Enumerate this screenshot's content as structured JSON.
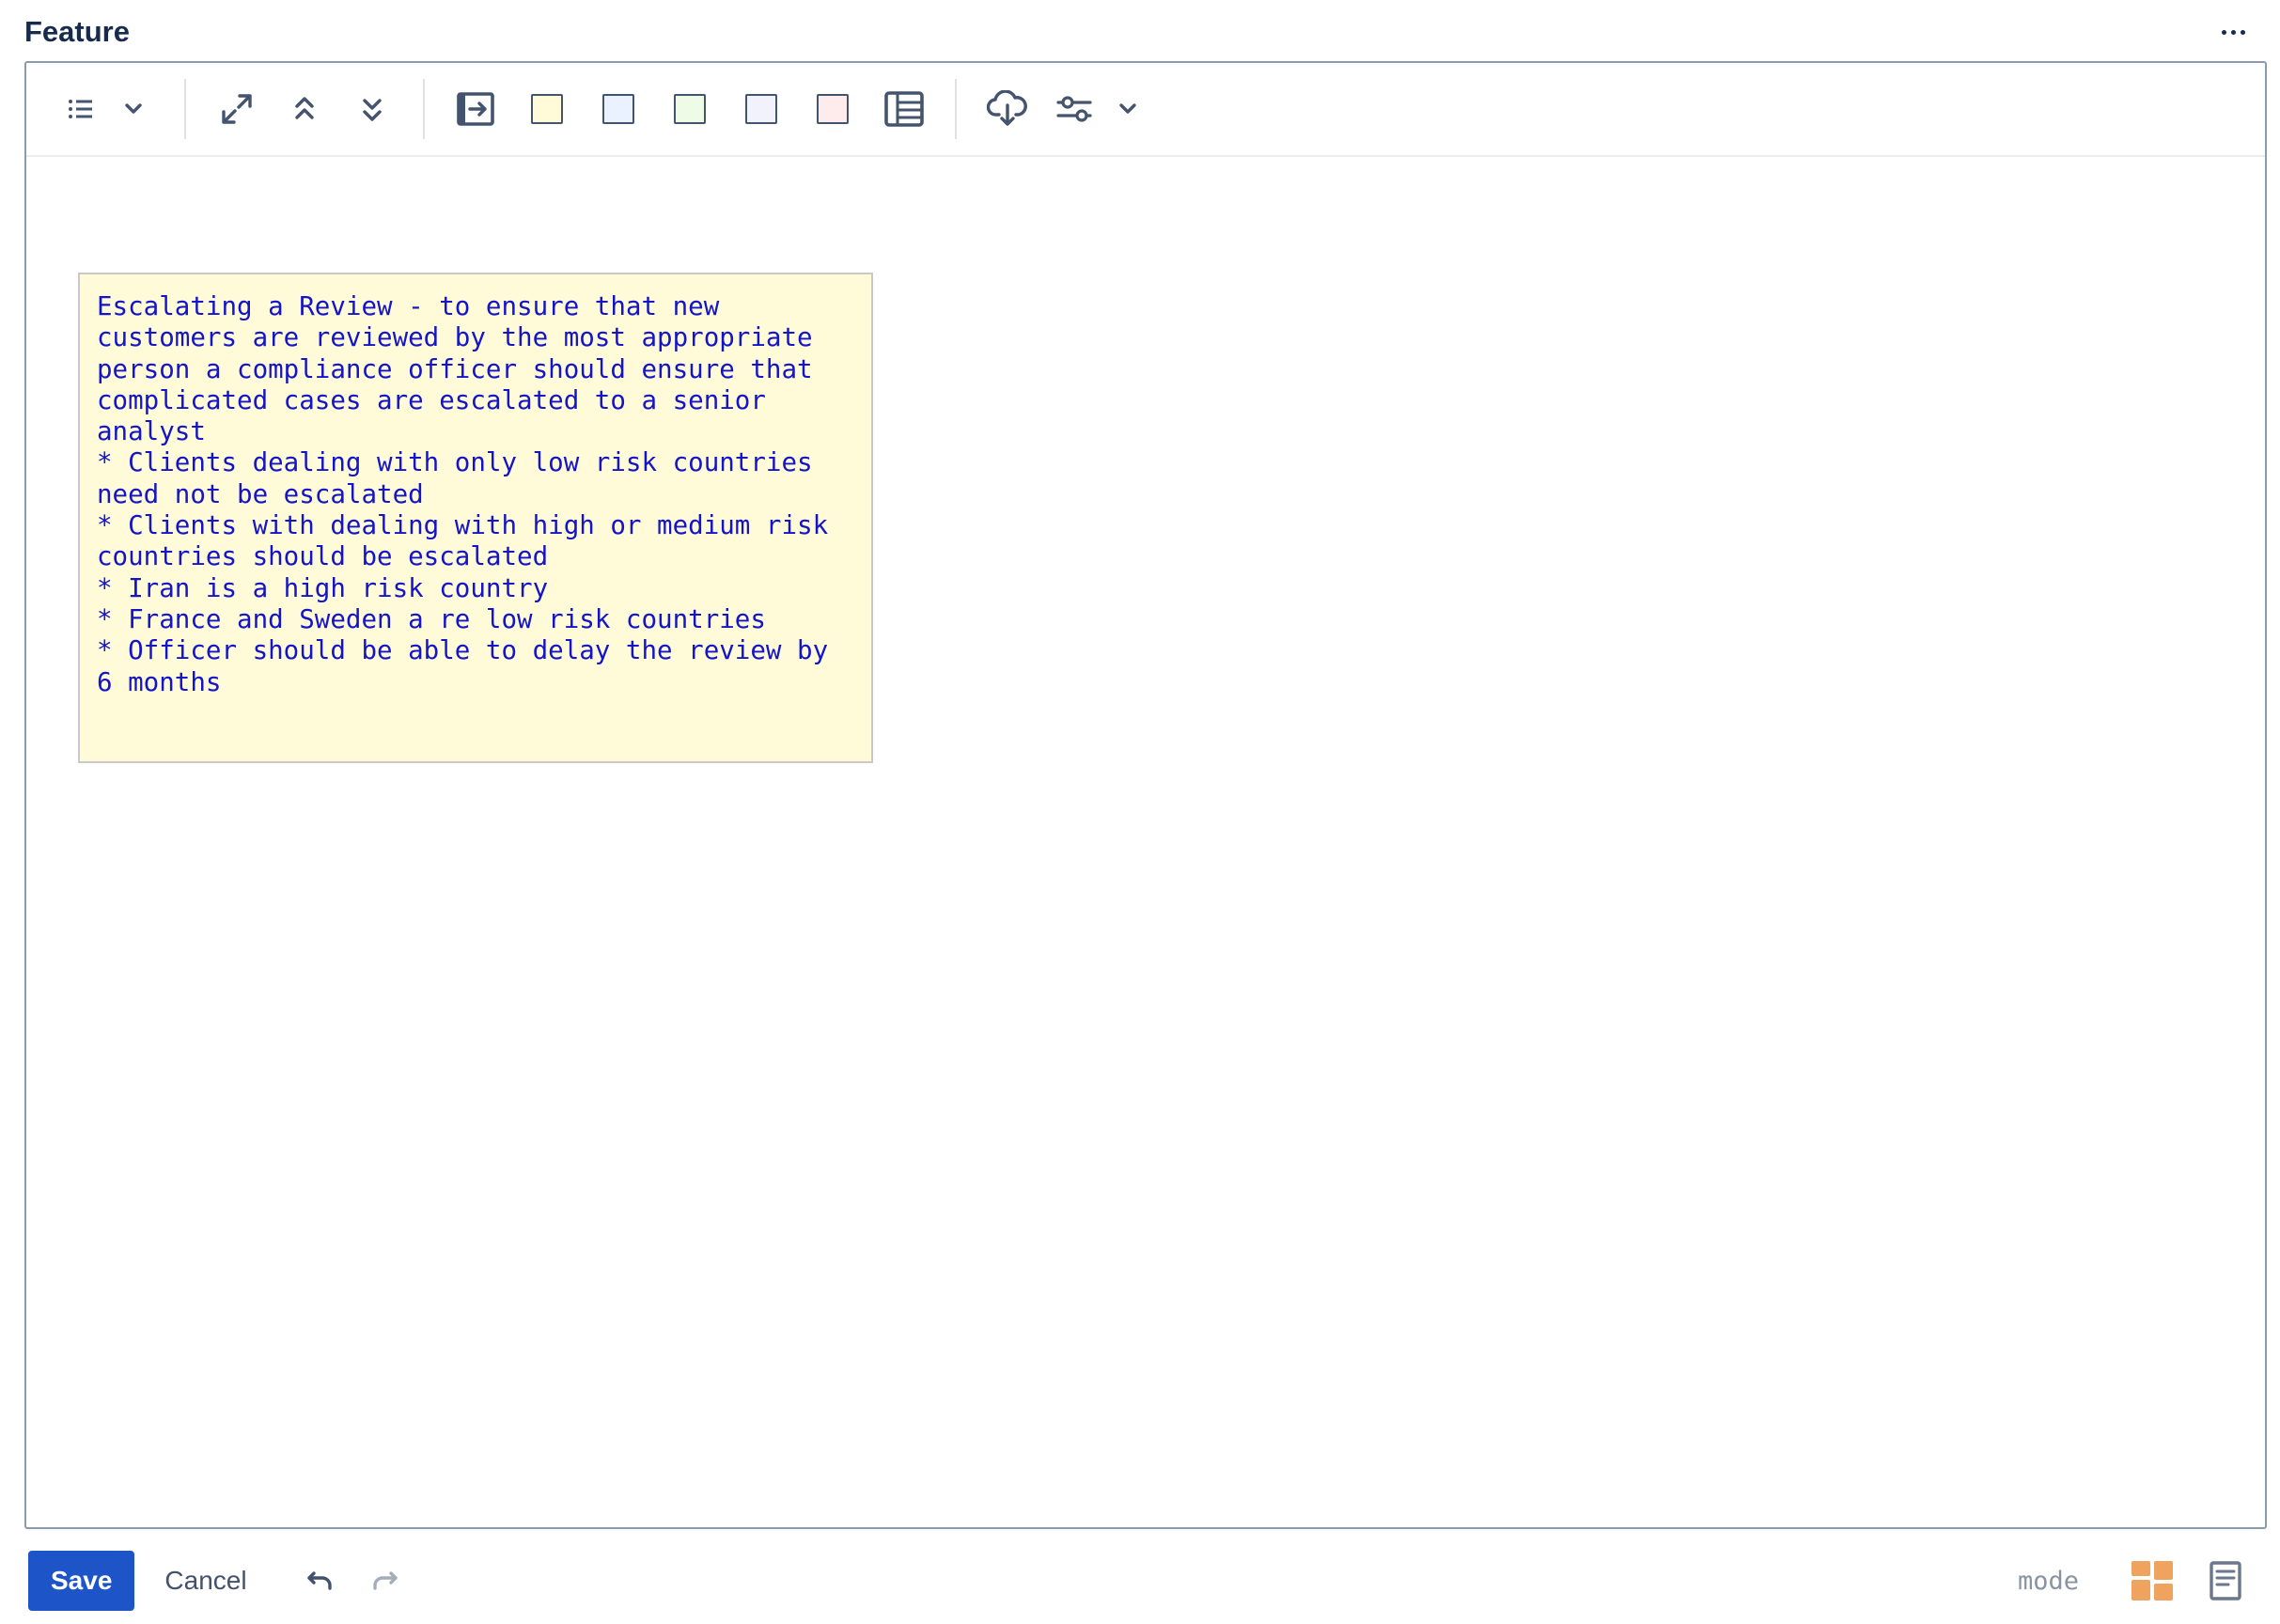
{
  "header": {
    "title": "Feature"
  },
  "toolbar": {
    "items": [
      {
        "icon": "list-icon",
        "interactable": true
      },
      {
        "icon": "chevron-down-icon",
        "interactable": true
      },
      {
        "icon": "expand-icon",
        "interactable": true
      },
      {
        "icon": "collapse-up-icon",
        "interactable": true
      },
      {
        "icon": "expand-down-icon",
        "interactable": true
      },
      {
        "icon": "insert-arrow-icon",
        "interactable": true
      },
      {
        "icon": "sticky-yellow-swatch",
        "color": "#fffbd9"
      },
      {
        "icon": "sticky-blue-swatch",
        "color": "#ebf2ff"
      },
      {
        "icon": "sticky-green-swatch",
        "color": "#eefbe6"
      },
      {
        "icon": "sticky-lavender-swatch",
        "color": "#f1f2fb"
      },
      {
        "icon": "sticky-pink-swatch",
        "color": "#fdeceb"
      },
      {
        "icon": "table-icon"
      },
      {
        "icon": "cloud-download-icon"
      },
      {
        "icon": "sliders-icon"
      },
      {
        "icon": "chevron-down-icon"
      }
    ]
  },
  "sticky": {
    "text": "Escalating a Review - to ensure that new\ncustomers are reviewed by the most appropriate\nperson a compliance officer should ensure that\ncomplicated cases are escalated to a senior\nanalyst\n* Clients dealing with only low risk countries\nneed not be escalated\n* Clients with dealing with high or medium risk\ncountries should be escalated\n* Iran is a high risk country\n* France and Sweden a re low risk countries\n* Officer should be able to delay the review by\n6 months",
    "background": "#fffbd9",
    "text_color": "#1414c8"
  },
  "footer": {
    "save_label": "Save",
    "cancel_label": "Cancel",
    "mode_label": "mode"
  },
  "colors": {
    "primary": "#1d55c9",
    "mode_active": "#f0a35e",
    "icon": "#44546f"
  }
}
